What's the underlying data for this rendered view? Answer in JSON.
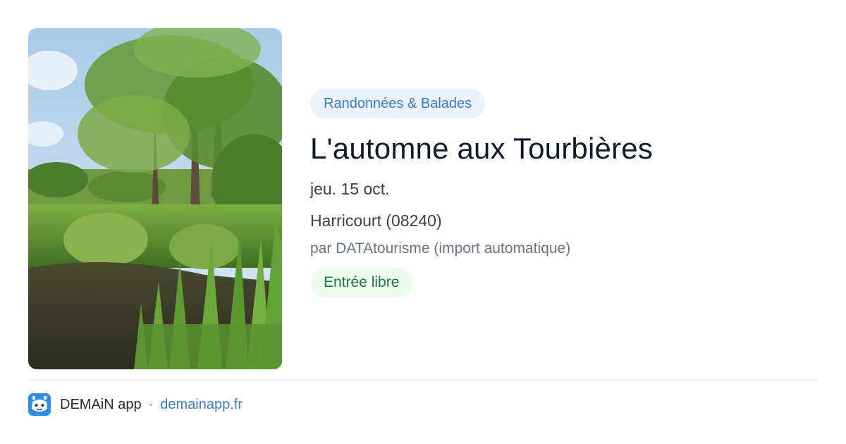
{
  "event": {
    "category": "Randonnées & Balades",
    "title": "L'automne aux Tourbières",
    "date": "jeu. 15 oct.",
    "location": "Harricourt (08240)",
    "organizer": "par DATAtourisme (import automatique)",
    "price": "Entrée libre",
    "photo_icon": "marsh-landscape-photo"
  },
  "footer": {
    "logo_icon": "demain-app-logo-icon",
    "app_name": "DEMAiN app",
    "separator": "·",
    "site": "demainapp.fr"
  },
  "colors": {
    "category_bg": "#eaf2fc",
    "category_text": "#3a7bc8",
    "price_bg": "#ecfaf0",
    "price_text": "#1e7a3f",
    "title_text": "#111a2b",
    "link": "#3a7bc8"
  }
}
